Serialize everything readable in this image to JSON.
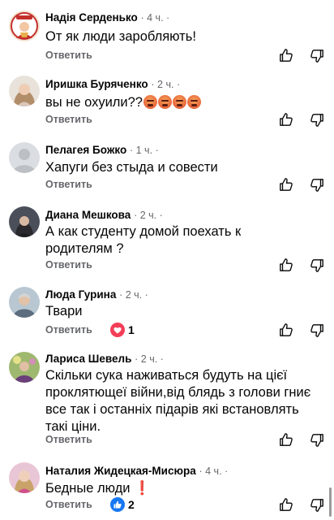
{
  "comments": [
    {
      "author": "Надія Серденько",
      "time": "· 4 ч. ·",
      "text": "От як люди заробляють!",
      "reply": "Ответить"
    },
    {
      "author": "Иришка Буряченко",
      "time": "· 2 ч. ·",
      "text": "вы не охуили??",
      "reply": "Ответить",
      "emoji": "angry-face-icon",
      "emoji_count": 4
    },
    {
      "author": "Пелагея Божко",
      "time": "· 1 ч. ·",
      "text": "Хапуги без стыда и совести",
      "reply": "Ответить"
    },
    {
      "author": "Диана Мешкова",
      "time": "· 2 ч. ·",
      "text_lines": [
        "А как студенту домой поехать к",
        "родителям ?"
      ],
      "reply": "Ответить"
    },
    {
      "author": "Люда Гурина",
      "time": "· 2 ч. ·",
      "text": "Твари",
      "reply": "Ответить",
      "reaction": {
        "icon": "heart-reaction-icon",
        "count": "1",
        "color": "#f33e58"
      }
    },
    {
      "author": "Лариса Шевель",
      "time": "· 2 ч. ·",
      "text_lines": [
        "Скільки сука наживаться будуть на цієї",
        "проклятющеї війни,від блядь з голови гниє",
        "все так і останніх підарів які встановлять",
        "такі ціни."
      ],
      "reply": "Ответить"
    },
    {
      "author": "Наталия Жидецкая-Мисюра",
      "time": "· 4 ч. ·",
      "text": "Бедные люди",
      "reply": "Ответить",
      "text_suffix": "❗",
      "reaction": {
        "icon": "like-reaction-icon",
        "count": "2",
        "color": "#1877f2"
      }
    }
  ],
  "colors": {
    "secondary_text": "#65676b",
    "primary_text": "#050505"
  }
}
